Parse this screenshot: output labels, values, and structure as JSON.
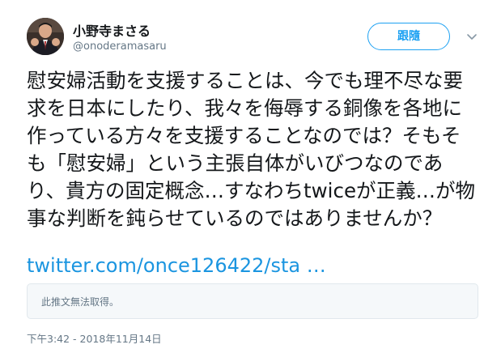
{
  "user": {
    "display_name": "小野寺まさる",
    "handle": "@onoderamasaru",
    "avatar_icon": "profile-photo"
  },
  "actions": {
    "follow_label": "跟隨",
    "menu_icon": "chevron-down-icon"
  },
  "tweet": {
    "text": "慰安婦活動を支援することは、今でも理不尽な要求を日本にしたり、我々を侮辱する銅像を各地に作っている方々を支援することなのでは？そもそも「慰安婦」という主張自体がいびつなのであり、貴方の固定概念…すなわちtwiceが正義…が物事な判断を鈍らせているのではありませんか？",
    "link": "twitter.com/once126422/sta …",
    "quoted_unavailable": "此推文無法取得。",
    "timestamp": "下午3:42 - 2018年11月14日"
  },
  "colors": {
    "accent": "#1da1f2",
    "link": "#1b95e0",
    "secondary_text": "#657786",
    "card_bg": "#f5f8fa",
    "border": "#e1e8ed"
  }
}
